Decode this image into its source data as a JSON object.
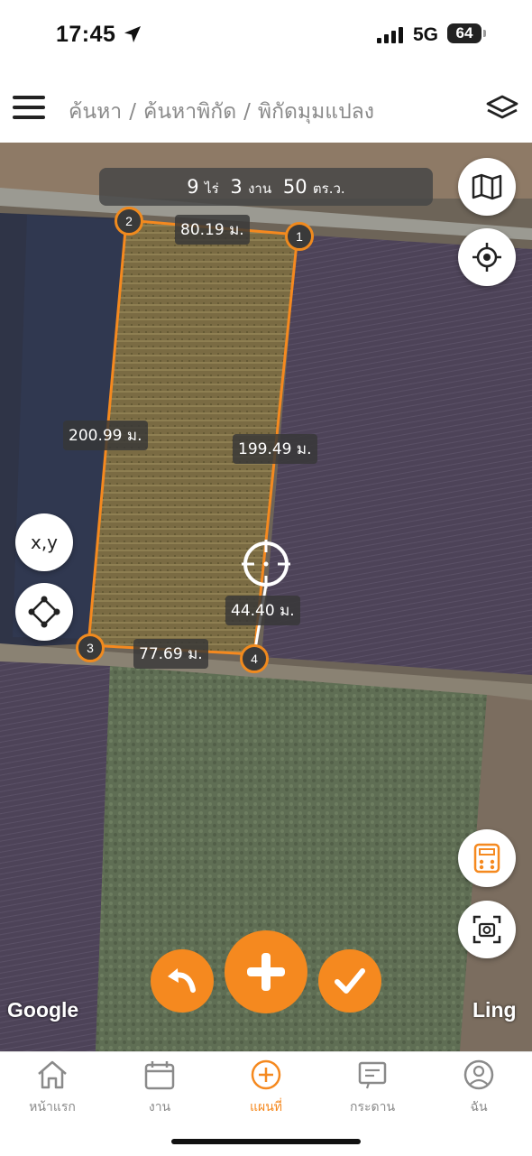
{
  "status_bar": {
    "time": "17:45",
    "network": "5G",
    "battery": "64"
  },
  "header": {
    "breadcrumb": [
      "ค้นหา",
      "ค้นหาพิกัด",
      "พิกัดมุมแปลง"
    ],
    "separator": "/"
  },
  "map": {
    "area": {
      "rai_value": "9",
      "rai_unit": "ไร่",
      "ngan_value": "3",
      "ngan_unit": "งาน",
      "wa_value": "50",
      "wa_unit": "ตร.ว."
    },
    "measurements": {
      "top": "80.19 ม.",
      "left": "200.99 ม.",
      "right": "199.49 ม.",
      "bottom": "77.69 ม.",
      "cursor": "44.40 ม."
    },
    "vertices": [
      "1",
      "2",
      "3",
      "4"
    ],
    "buttons": {
      "xy_label": "x,y"
    },
    "watermark_left": "Google",
    "watermark_right": "Ling",
    "accent_color": "#f5891f"
  },
  "tabs": [
    {
      "label": "หน้าแรก",
      "icon": "home-icon",
      "active": false
    },
    {
      "label": "งาน",
      "icon": "calendar-icon",
      "active": false
    },
    {
      "label": "แผนที่",
      "icon": "plus-circle-icon",
      "active": true
    },
    {
      "label": "กระดาน",
      "icon": "board-icon",
      "active": false
    },
    {
      "label": "ฉัน",
      "icon": "user-icon",
      "active": false
    }
  ]
}
